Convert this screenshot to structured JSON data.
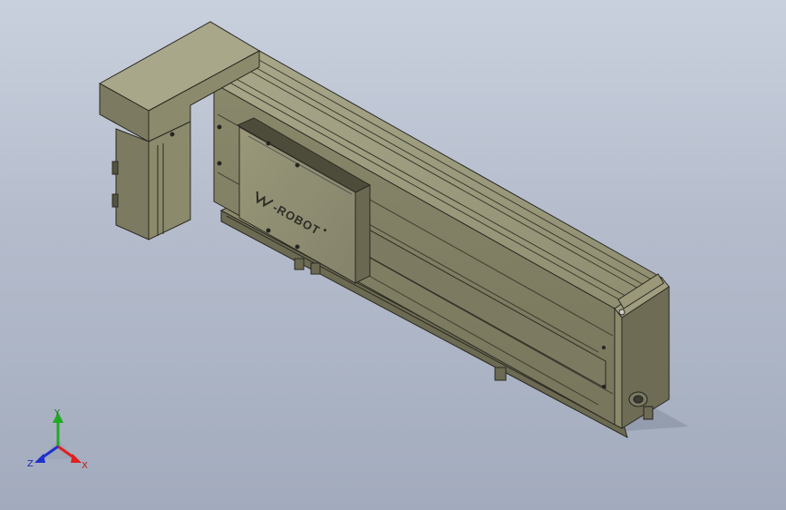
{
  "viewport": {
    "background_top": "#c9d0dd",
    "background_bottom": "#a2abbd"
  },
  "model": {
    "logo_text": "-ROBOT",
    "body_color": "#8c8a6c",
    "dark_color": "#5f5e48",
    "edge_color": "#2a2a22"
  },
  "triad": {
    "x_label": "X",
    "y_label": "Y",
    "z_label": "Z",
    "x_color": "#e02020",
    "y_color": "#22aa22",
    "z_color": "#2030d0"
  }
}
